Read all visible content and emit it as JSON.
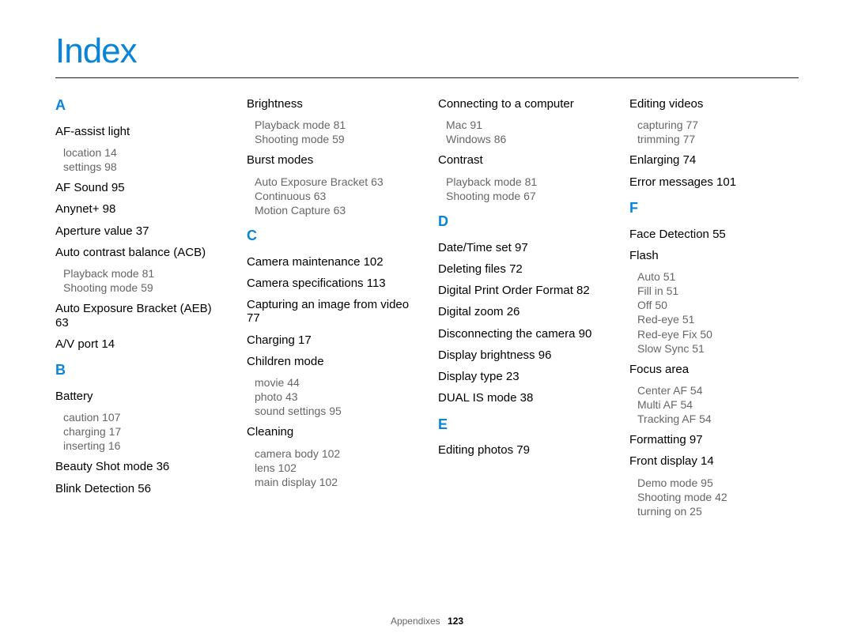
{
  "title": "Index",
  "footer": {
    "section": "Appendixes",
    "page": "123"
  },
  "col1": {
    "A": "A",
    "af_assist_light": "AF-assist light",
    "af_assist_light_subs": [
      {
        "label": "location",
        "pg": "14"
      },
      {
        "label": "settings",
        "pg": "98"
      }
    ],
    "af_sound": {
      "label": "AF Sound",
      "pg": "95"
    },
    "anynet": {
      "label": "Anynet+",
      "pg": "98"
    },
    "aperture": {
      "label": "Aperture value",
      "pg": "37"
    },
    "acb": "Auto contrast balance (ACB)",
    "acb_subs": [
      {
        "label": "Playback mode",
        "pg": "81"
      },
      {
        "label": "Shooting mode",
        "pg": "59"
      }
    ],
    "aeb": {
      "label": "Auto Exposure Bracket (AEB)",
      "pg": "63"
    },
    "av_port": {
      "label": "A/V port",
      "pg": "14"
    },
    "B": "B",
    "battery": "Battery",
    "battery_subs": [
      {
        "label": "caution",
        "pg": "107"
      },
      {
        "label": "charging",
        "pg": "17"
      },
      {
        "label": "inserting",
        "pg": "16"
      }
    ],
    "beauty": {
      "label": "Beauty Shot mode",
      "pg": "36"
    },
    "blink": {
      "label": "Blink Detection",
      "pg": "56"
    }
  },
  "col2": {
    "brightness": "Brightness",
    "brightness_subs": [
      {
        "label": "Playback mode",
        "pg": "81"
      },
      {
        "label": "Shooting mode",
        "pg": "59"
      }
    ],
    "burst": "Burst modes",
    "burst_subs": [
      {
        "label": "Auto Exposure Bracket",
        "pg": "63"
      },
      {
        "label": "Continuous",
        "pg": "63"
      },
      {
        "label": "Motion Capture",
        "pg": "63"
      }
    ],
    "C": "C",
    "cam_maint": {
      "label": "Camera maintenance",
      "pg": "102"
    },
    "cam_spec": {
      "label": "Camera specifications",
      "pg": "113"
    },
    "capture_video": {
      "label": "Capturing an image from video",
      "pg": "77"
    },
    "charging": {
      "label": "Charging",
      "pg": "17"
    },
    "children": "Children mode",
    "children_subs": [
      {
        "label": "movie",
        "pg": "44"
      },
      {
        "label": "photo",
        "pg": "43"
      },
      {
        "label": "sound settings",
        "pg": "95"
      }
    ],
    "cleaning": "Cleaning",
    "cleaning_subs": [
      {
        "label": "camera body",
        "pg": "102"
      },
      {
        "label": "lens",
        "pg": "102"
      },
      {
        "label": "main display",
        "pg": "102"
      }
    ]
  },
  "col3": {
    "connecting": "Connecting to a computer",
    "connecting_subs": [
      {
        "label": "Mac",
        "pg": "91"
      },
      {
        "label": "Windows",
        "pg": "86"
      }
    ],
    "contrast": "Contrast",
    "contrast_subs": [
      {
        "label": "Playback mode",
        "pg": "81"
      },
      {
        "label": "Shooting mode",
        "pg": "67"
      }
    ],
    "D": "D",
    "datetime": {
      "label": "Date/Time set",
      "pg": "97"
    },
    "deleting": {
      "label": "Deleting files",
      "pg": "72"
    },
    "dpof": {
      "label": "Digital Print Order Format",
      "pg": "82"
    },
    "dzoom": {
      "label": "Digital zoom",
      "pg": "26"
    },
    "disconnect": {
      "label": "Disconnecting the camera",
      "pg": "90"
    },
    "disp_bright": {
      "label": "Display brightness",
      "pg": "96"
    },
    "disp_type": {
      "label": "Display type",
      "pg": "23"
    },
    "dual_is": {
      "label": "DUAL IS mode",
      "pg": "38"
    },
    "E": "E",
    "edit_photos": {
      "label": "Editing photos",
      "pg": "79"
    }
  },
  "col4": {
    "edit_videos": "Editing videos",
    "edit_videos_subs": [
      {
        "label": "capturing",
        "pg": "77"
      },
      {
        "label": "trimming",
        "pg": "77"
      }
    ],
    "enlarging": {
      "label": "Enlarging",
      "pg": "74"
    },
    "error": {
      "label": "Error messages",
      "pg": "101"
    },
    "F": "F",
    "face_det": {
      "label": "Face Detection",
      "pg": "55"
    },
    "flash": "Flash",
    "flash_subs": [
      {
        "label": "Auto",
        "pg": "51"
      },
      {
        "label": "Fill in",
        "pg": "51"
      },
      {
        "label": "Off",
        "pg": "50"
      },
      {
        "label": "Red-eye",
        "pg": "51"
      },
      {
        "label": "Red-eye Fix",
        "pg": "50"
      },
      {
        "label": "Slow Sync",
        "pg": "51"
      }
    ],
    "focus_area": "Focus area",
    "focus_area_subs": [
      {
        "label": "Center AF",
        "pg": "54"
      },
      {
        "label": "Multi AF",
        "pg": "54"
      },
      {
        "label": "Tracking AF",
        "pg": "54"
      }
    ],
    "formatting": {
      "label": "Formatting",
      "pg": "97"
    },
    "front_display": {
      "label": "Front display",
      "pg": "14"
    },
    "front_display_subs": [
      {
        "label": "Demo mode",
        "pg": "95"
      },
      {
        "label": "Shooting mode",
        "pg": "42"
      },
      {
        "label": "turning on",
        "pg": "25"
      }
    ]
  }
}
